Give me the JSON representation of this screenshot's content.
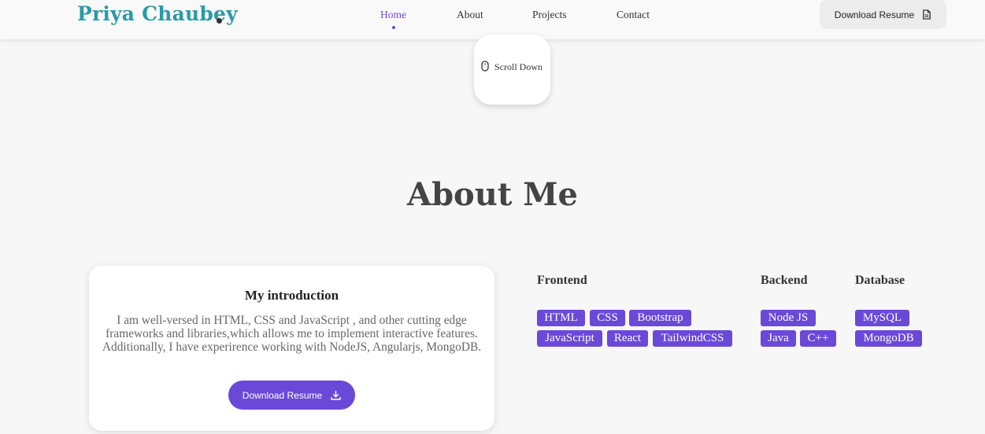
{
  "header": {
    "brand": "Priya Chaubey",
    "nav": [
      {
        "label": "Home",
        "active": true
      },
      {
        "label": "About",
        "active": false
      },
      {
        "label": "Projects",
        "active": false
      },
      {
        "label": "Contact",
        "active": false
      }
    ],
    "resume_button": "Download Resume",
    "resume_icon": "document-icon"
  },
  "hero": {
    "scroll_label": "Scroll Down",
    "scroll_icon": "mouse-icon"
  },
  "about": {
    "title": "About Me",
    "intro": {
      "title": "My introduction",
      "text": "I am well-versed in HTML, CSS and JavaScript , and other cutting edge frameworks and libraries,which allows me to implement interactive features. Additionally, I have experirence working with NodeJS, Angularjs, MongoDB.",
      "button": "Download Resume",
      "button_icon": "download-icon"
    },
    "skills": {
      "frontend": {
        "title": "Frontend",
        "tags": [
          "HTML",
          "CSS",
          "Bootstrap",
          "JavaScript",
          "React",
          "TailwindCSS"
        ]
      },
      "backend": {
        "title": "Backend",
        "tags": [
          "Node JS",
          "Java",
          "C++"
        ]
      },
      "database": {
        "title": "Database",
        "tags": [
          "MySQL",
          "MongoDB"
        ]
      }
    }
  },
  "colors": {
    "brand": "#2a9aa8",
    "accent": "#6b49d8",
    "background": "#f7f7f7"
  }
}
